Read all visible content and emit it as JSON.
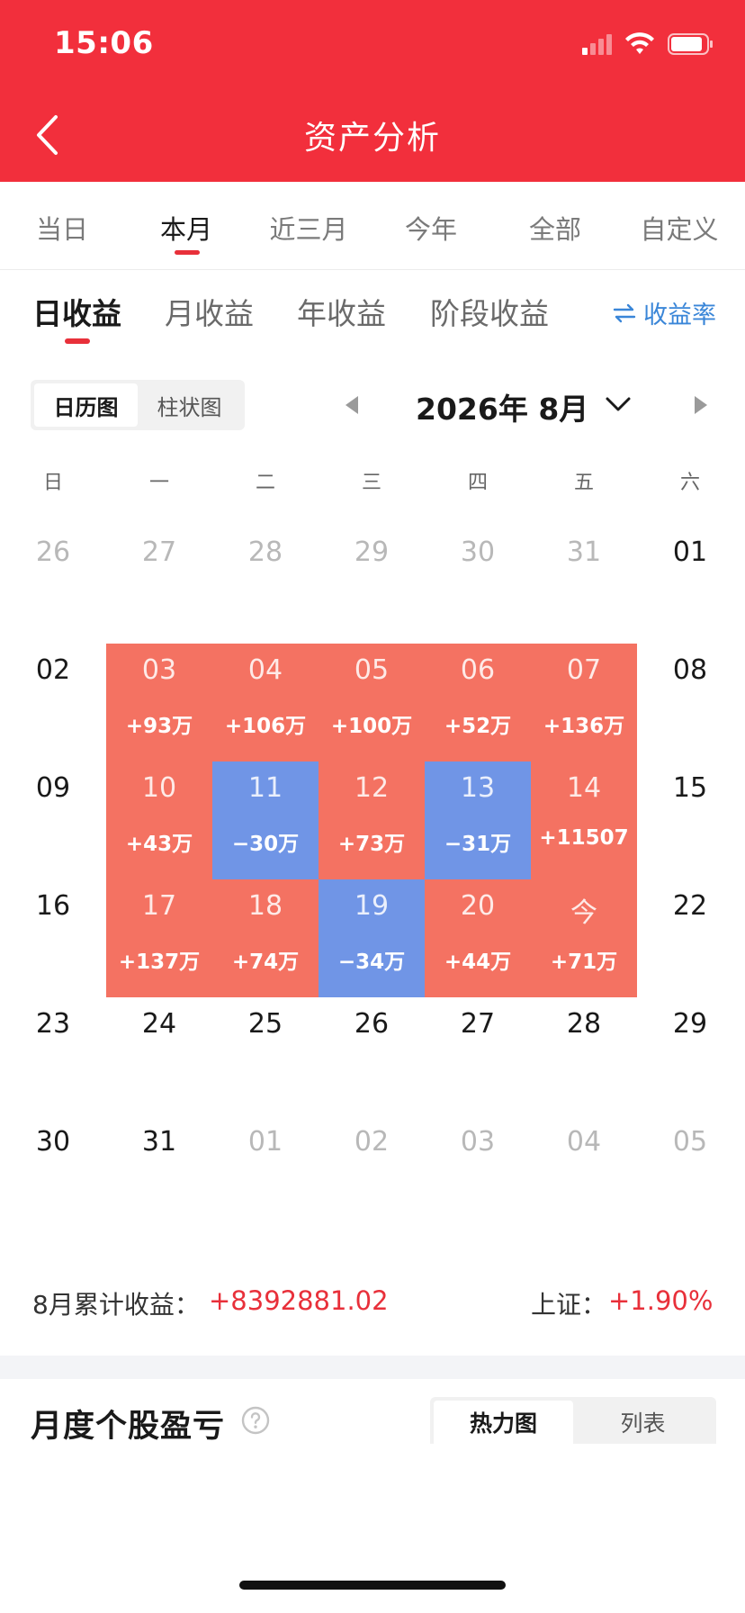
{
  "status_bar": {
    "time": "15:06"
  },
  "header": {
    "title": "资产分析",
    "accent_color": "#f22f3c"
  },
  "period_tabs": [
    {
      "label": "当日",
      "active": false
    },
    {
      "label": "本月",
      "active": true
    },
    {
      "label": "近三月",
      "active": false
    },
    {
      "label": "今年",
      "active": false
    },
    {
      "label": "全部",
      "active": false
    },
    {
      "label": "自定义",
      "active": false
    }
  ],
  "sub_tabs": [
    {
      "label": "日收益",
      "active": true
    },
    {
      "label": "月收益",
      "active": false
    },
    {
      "label": "年收益",
      "active": false
    },
    {
      "label": "阶段收益",
      "active": false
    }
  ],
  "rate_link": {
    "icon": "swap-icon",
    "label": "收益率"
  },
  "view_toggle": {
    "calendar": "日历图",
    "bar": "柱状图",
    "selected": "calendar"
  },
  "month_nav": {
    "label": "2026年 8月"
  },
  "weekdays": [
    "日",
    "一",
    "二",
    "三",
    "四",
    "五",
    "六"
  ],
  "calendar_weeks": [
    [
      {
        "day": "26",
        "type": "other"
      },
      {
        "day": "27",
        "type": "other"
      },
      {
        "day": "28",
        "type": "other"
      },
      {
        "day": "29",
        "type": "other"
      },
      {
        "day": "30",
        "type": "other"
      },
      {
        "day": "31",
        "type": "other"
      },
      {
        "day": "01",
        "type": "cur"
      }
    ],
    [
      {
        "day": "02",
        "type": "cur"
      },
      {
        "day": "03",
        "type": "pos",
        "value": "+93万"
      },
      {
        "day": "04",
        "type": "pos",
        "value": "+106万"
      },
      {
        "day": "05",
        "type": "pos",
        "value": "+100万"
      },
      {
        "day": "06",
        "type": "pos",
        "value": "+52万"
      },
      {
        "day": "07",
        "type": "pos",
        "value": "+136万"
      },
      {
        "day": "08",
        "type": "cur"
      }
    ],
    [
      {
        "day": "09",
        "type": "cur"
      },
      {
        "day": "10",
        "type": "pos",
        "value": "+43万"
      },
      {
        "day": "11",
        "type": "neg",
        "value": "−30万"
      },
      {
        "day": "12",
        "type": "pos",
        "value": "+73万"
      },
      {
        "day": "13",
        "type": "neg",
        "value": "−31万"
      },
      {
        "day": "14",
        "type": "pos",
        "value": "+11507"
      },
      {
        "day": "15",
        "type": "cur"
      }
    ],
    [
      {
        "day": "16",
        "type": "cur"
      },
      {
        "day": "17",
        "type": "pos",
        "value": "+137万"
      },
      {
        "day": "18",
        "type": "pos",
        "value": "+74万"
      },
      {
        "day": "19",
        "type": "neg",
        "value": "−34万"
      },
      {
        "day": "20",
        "type": "pos",
        "value": "+44万"
      },
      {
        "day": "今",
        "type": "pos",
        "value": "+71万"
      },
      {
        "day": "22",
        "type": "cur"
      }
    ],
    [
      {
        "day": "23",
        "type": "cur"
      },
      {
        "day": "24",
        "type": "cur"
      },
      {
        "day": "25",
        "type": "cur"
      },
      {
        "day": "26",
        "type": "cur"
      },
      {
        "day": "27",
        "type": "cur"
      },
      {
        "day": "28",
        "type": "cur"
      },
      {
        "day": "29",
        "type": "cur"
      }
    ],
    [
      {
        "day": "30",
        "type": "cur"
      },
      {
        "day": "31",
        "type": "cur"
      },
      {
        "day": "01",
        "type": "other"
      },
      {
        "day": "02",
        "type": "other"
      },
      {
        "day": "03",
        "type": "other"
      },
      {
        "day": "04",
        "type": "other"
      },
      {
        "day": "05",
        "type": "other"
      }
    ]
  ],
  "summary": {
    "cum_label": "8月累计收益：",
    "cum_value": "+8392881.02",
    "index_label": "上证：",
    "index_value": "+1.90%"
  },
  "monthly_section": {
    "title": "月度个股盈亏",
    "toggle": {
      "heatmap": "热力图",
      "list": "列表",
      "selected": "heatmap"
    }
  },
  "colors": {
    "gain": "#f47262",
    "loss": "#7095e6",
    "red_text": "#e8303a",
    "link": "#3a86d8"
  }
}
